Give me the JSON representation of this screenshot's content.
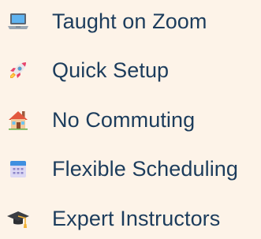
{
  "features": [
    {
      "icon": "laptop-icon",
      "label": "Taught on Zoom"
    },
    {
      "icon": "rocket-icon",
      "label": "Quick Setup"
    },
    {
      "icon": "house-icon",
      "label": "No Commuting"
    },
    {
      "icon": "calendar-icon",
      "label": "Flexible Scheduling"
    },
    {
      "icon": "graduation-cap-icon",
      "label": "Expert Instructors"
    }
  ],
  "colors": {
    "background": "#fdf3e8",
    "text": "#1c3c5c"
  }
}
